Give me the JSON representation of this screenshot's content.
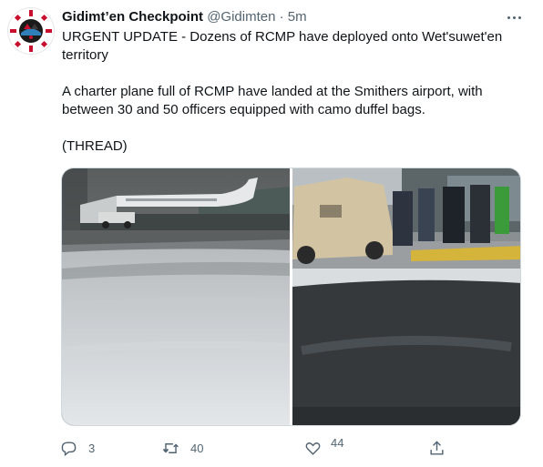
{
  "tweet": {
    "display_name": "Gidimt’en Checkpoint",
    "handle": "@Gidimten",
    "separator": "·",
    "time": "5m",
    "paragraphs": [
      "URGENT UPDATE - Dozens of RCMP have deployed onto Wet'suwet'en territory",
      "A charter plane full of RCMP have landed at the Smithers airport, with between 30 and 50 officers equipped with camo duffel bags.",
      "(THREAD)"
    ]
  },
  "media": {
    "count": 2,
    "photos": [
      "airport-runway-plane-photo",
      "rcmp-officers-truck-photo"
    ]
  },
  "actions": {
    "reply_count": "3",
    "retweet_count": "40",
    "like_count": "44",
    "icons": [
      "reply-icon",
      "retweet-icon",
      "heart-icon",
      "share-icon"
    ]
  },
  "colors": {
    "text": "#0f1419",
    "secondary": "#536471",
    "border": "#cfd9de"
  }
}
